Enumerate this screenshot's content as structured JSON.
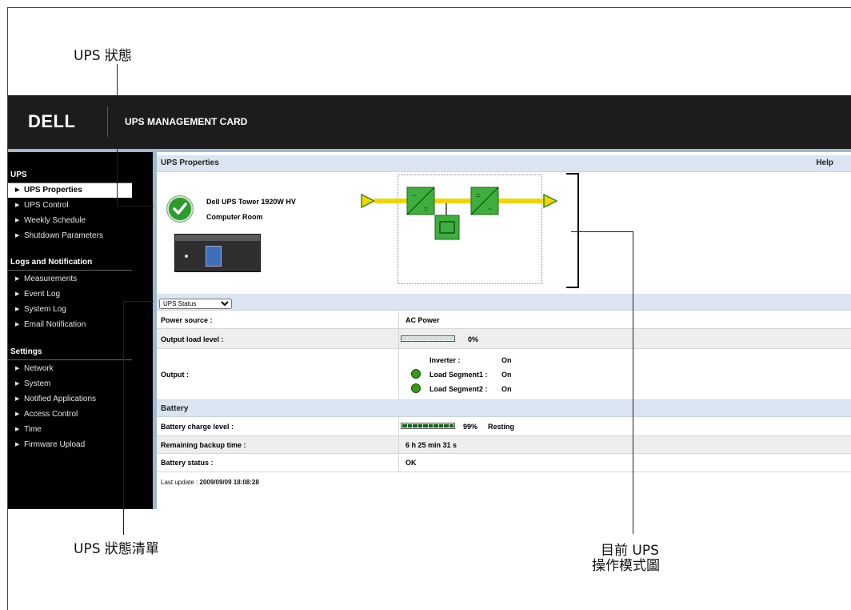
{
  "callouts": {
    "ups_status": "UPS 狀態",
    "ups_status_list": "UPS 狀態清單",
    "mode_diagram_line1": "目前 UPS",
    "mode_diagram_line2": "操作模式圖"
  },
  "header": {
    "logo": "DELL",
    "title": "UPS MANAGEMENT CARD"
  },
  "sidebar": {
    "sections": [
      {
        "title": "UPS",
        "items": [
          "UPS Properties",
          "UPS Control",
          "Weekly Schedule",
          "Shutdown Parameters"
        ]
      },
      {
        "title": "Logs and Notification",
        "items": [
          "Measurements",
          "Event Log",
          "System Log",
          "Email Notification"
        ]
      },
      {
        "title": "Settings",
        "items": [
          "Network",
          "System",
          "Notified Applications",
          "Access Control",
          "Time",
          "Firmware Upload"
        ]
      }
    ],
    "active_item": "UPS Properties"
  },
  "main": {
    "title": "UPS Properties",
    "help": "Help",
    "model": "Dell UPS Tower 1920W HV",
    "location": "Computer Room",
    "status_select": {
      "selected": "UPS Status",
      "options": [
        "UPS Status"
      ]
    },
    "rows": {
      "power_source": {
        "label": "Power source :",
        "value": "AC Power"
      },
      "output_load": {
        "label": "Output load level :",
        "value": "0%",
        "level": 0
      },
      "output": {
        "label": "Output :",
        "inverter_label": "Inverter :",
        "inverter_value": "On",
        "seg1_label": "Load Segment1 :",
        "seg1_value": "On",
        "seg2_label": "Load Segment2 :",
        "seg2_value": "On"
      },
      "battery_section": "Battery",
      "battery_charge": {
        "label": "Battery charge level :",
        "value": "99%",
        "state": "Resting",
        "level": 0.99
      },
      "backup_time": {
        "label": "Remaining backup time :",
        "value": "6 h 25 min 31 s"
      },
      "battery_status": {
        "label": "Battery status :",
        "value": "OK"
      }
    },
    "last_update_label": "Last update :",
    "last_update_value": "2009/09/09 18:08:28"
  },
  "colors": {
    "accent_bar": "#dbe5f2",
    "sidebar_strip": "#9fb7cc",
    "diagram_green": "#3fae3f",
    "flow_yellow": "#f2d400"
  }
}
